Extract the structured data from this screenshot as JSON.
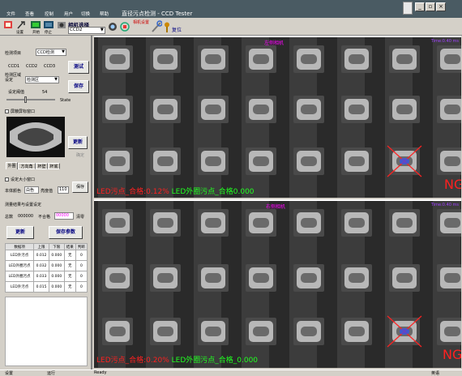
{
  "menu": {
    "items": [
      "文件",
      "查看",
      "控制",
      "用户",
      "切换",
      "帮助"
    ]
  },
  "app_title": "直径污点检测 - CCD Tester",
  "toolbar": {
    "labels": [
      "",
      "设置",
      "开始",
      "停止"
    ],
    "camera_label": "相机选择",
    "camera_value": "CCD2",
    "camera_settings": "相机设置",
    "reset": "复位"
  },
  "left": {
    "detect_item_label": "检测项目",
    "detect_item_value": "CCD检测",
    "ccd1": "CCD1",
    "ccd2": "CCD2",
    "ccd3": "CCD3",
    "test_btn": "测试",
    "region_label": "检测区域设定",
    "region_value": "检测区",
    "save_btn": "保存",
    "threshold_label": "设定阈值",
    "threshold_value": "54",
    "state_label": "State",
    "show_window_label": "屏蔽屏标窗口",
    "update_btn": "更新",
    "ok_label": "确定",
    "tabs": [
      "外圈",
      "方向角",
      "杯壁",
      "杯底"
    ],
    "size_window_label": "设定大小窗口",
    "color_label": "本体颜色",
    "color_value": "白色",
    "brightness_label": "亮度值",
    "brightness_value": "110",
    "save_small": "保存",
    "result_title": "测量结果与设置设定",
    "count_label": "总数",
    "count_value": "000000",
    "bad_label": "不合格",
    "bad_value": "00000",
    "clear_label": "清零",
    "update_btn2": "更新",
    "save_params_btn": "保存参数",
    "table": {
      "headers": [
        "数据项",
        "上限",
        "下限",
        "结果",
        "判断"
      ],
      "rows": [
        [
          "LED外污点",
          "0.012",
          "0.000",
          "无",
          "0"
        ],
        [
          "LED外圈污点",
          "0.032",
          "0.000",
          "无",
          "0"
        ],
        [
          "LED外圈污点",
          "0.033",
          "0.000",
          "无",
          "0"
        ],
        [
          "LED外污点",
          "0.015",
          "0.000",
          "无",
          "0"
        ]
      ]
    }
  },
  "cam1": {
    "title": "左侧相机",
    "time": "Time:0.40 ms",
    "status_red": "LED污点_合格:0.12%",
    "status_green": "LED外圈污点_合格0.000",
    "ng": "NG"
  },
  "cam2": {
    "title": "右侧相机",
    "time": "Time:0.40 ms",
    "status_red": "LED污点_合格:0.20%",
    "status_green": "LED外圈污点_合格_0.000",
    "ng": "NG"
  },
  "status": {
    "left": "设置",
    "mid": "运行",
    "ready": "Ready",
    "right": "英语"
  }
}
